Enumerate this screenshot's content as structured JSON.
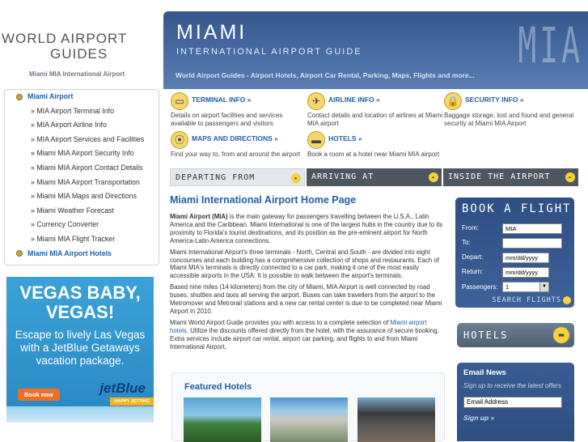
{
  "logo": {
    "line1": "WORLD AIRPORT",
    "line2": "GUIDES",
    "subtitle": "Miami MIA International Airport"
  },
  "banner": {
    "city": "MIAMI",
    "guide": "INTERNATIONAL AIRPORT GUIDE",
    "tagline": "World Airport Guides - Airport Hotels, Airport Car Rental, Parking, Maps, Flights and more...",
    "code": "MIA"
  },
  "sidebar": {
    "items": [
      {
        "label": "Miami Airport"
      },
      {
        "label": "» MIA Airport Terminal Info"
      },
      {
        "label": "» MIA Airport Airline Info"
      },
      {
        "label": "» MIA Airport Services and Facilities"
      },
      {
        "label": "» Miami MIA Airport Security Info"
      },
      {
        "label": "» Miami MIA Airport Contact Details"
      },
      {
        "label": "» Miami MIA Airport Transportation"
      },
      {
        "label": "» Miami MIA Maps and Directions"
      },
      {
        "label": "» Miami Weather Forecast"
      },
      {
        "label": "» Currency Converter"
      },
      {
        "label": "» Miami MIA Flight Tracker"
      },
      {
        "label": "Miami MIA Airport Hotels"
      }
    ]
  },
  "ad": {
    "headline": "VEGAS BABY, VEGAS!",
    "body": "Escape to lively Las Vegas with a JetBlue Getaways vacation package.",
    "button": "Book now",
    "brand": "jetBlue",
    "badge": "HAPPY JETTING"
  },
  "info": {
    "terminal": {
      "title": "TERMINAL INFO »",
      "desc": "Details on airport facilities and services available to passengers and visitors"
    },
    "airline": {
      "title": "AIRLINE INFO »",
      "desc": "Contact details and location of airlines at Miami MIA airport"
    },
    "security": {
      "title": "SECURITY INFO »",
      "desc": "Baggage storage, lost and found and general security at Miami MIA Airport"
    },
    "maps": {
      "title": "MAPS AND DIRECTIONS »",
      "desc": "Find your way to, from and around the airport"
    },
    "hotels": {
      "title": "HOTELS »",
      "desc": "Book a room at a hotel near Miami MIA airport"
    }
  },
  "strips": {
    "departing": "DEPARTING FROM",
    "arriving": "ARRIVING AT",
    "inside": "INSIDE THE AIRPORT"
  },
  "content": {
    "title": "Miami International Airport Home Page",
    "p1_lead": "Miami Airport (MIA)",
    "p1": " is the main gateway for passengers travelling between the U.S.A., Latin America and the Caribbean. Miami International is one of the largest hubs in the country due to its proximity to Florida's tourist destinations, and its position as the pre-eminent airport for North America-Latin America connections.",
    "p2": "Miami International Airport's three terminals - North, Central and South - are divided into eight concourses and each building has a comprehensive collection of shops and restaurants. Each of Miami MIA's terminals is directly connected to a car park, making it one of the most easily accessible airports in the USA. It is possible to walk between the airport's terminals.",
    "p3": "Based nine miles (14 kilometers) from the city of Miami, MIA Airport is well connected by road buses, shuttles and taxis all serving the airport. Buses can take travellers from the airport to the Metromover and Metrorail stations and a new car rental center is due to be completed near Miami Airport in 2010.",
    "p4_a": "Miami World Airport Guide provides you with access to a complete selection of ",
    "p4_link": "Miami airport hotels",
    "p4_b": ". Utilize the discounts offered directly from the hotel, with the assurance of secure booking. Extra services include airport car rental, airport car parking, and flights to and from Miami International Airport."
  },
  "featured": {
    "title": "Featured Hotels"
  },
  "booking": {
    "title": "BOOK A FLIGHT",
    "from_label": "From:",
    "from_value": "MIA",
    "to_label": "To:",
    "to_value": "",
    "depart_label": "Depart:",
    "depart_value": "mm/dd/yyyy",
    "return_label": "Return:",
    "return_value": "mm/dd/yyyy",
    "passengers_label": "Passengers:",
    "passengers_value": "1",
    "search": "SEARCH FLIGHTS"
  },
  "hotels_box": {
    "label": "HOTELS"
  },
  "email": {
    "title": "Email News",
    "desc": "Sign up to receive the latest offers",
    "placeholder": "Email Address",
    "signup": "Sign up »"
  }
}
